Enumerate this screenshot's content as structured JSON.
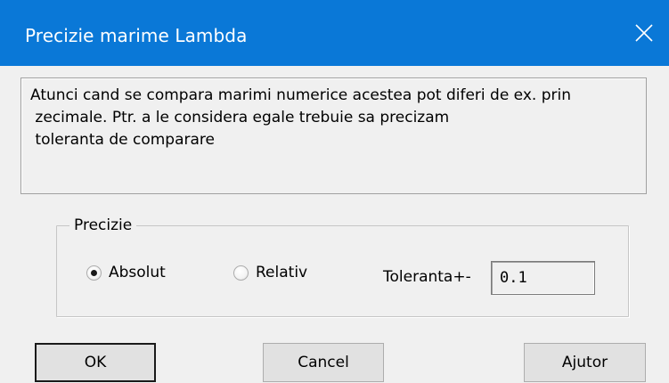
{
  "window": {
    "title": "Precizie marime Lambda",
    "close_icon": "close-icon"
  },
  "info": {
    "text": "Atunci cand se compara marimi numerice acestea pot diferi de ex. prin\n zecimale. Ptr. a le considera egale trebuie sa precizam\n toleranta de comparare"
  },
  "precision": {
    "group_label": "Precizie",
    "options": [
      {
        "label": "Absolut",
        "selected": true
      },
      {
        "label": "Relativ",
        "selected": false
      }
    ],
    "tolerance_label": "Toleranta+-",
    "tolerance_value": "0.1"
  },
  "buttons": {
    "ok": "OK",
    "cancel": "Cancel",
    "help": "Ajutor"
  },
  "colors": {
    "titlebar": "#0a78d7",
    "dialog_bg": "#f0f0f0",
    "button_bg": "#e1e1e1"
  }
}
